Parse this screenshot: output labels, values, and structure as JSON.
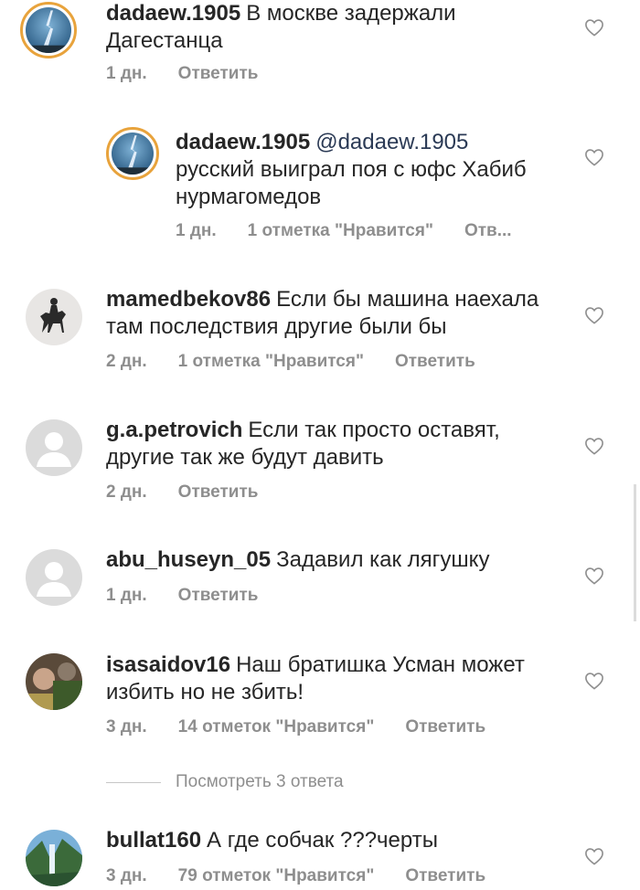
{
  "comments": [
    {
      "username": "dadaew.1905",
      "text": "В москве задержали Дагестанца",
      "time": "1 дн.",
      "reply": "Ответить"
    },
    {
      "username": "dadaew.1905",
      "mention": "@dadaew.1905",
      "text": "русский выиграл поя с юфс  Хабиб нурмагомедов",
      "time": "1 дн.",
      "likes": "1 отметка \"Нравится\"",
      "reply": "Отв..."
    },
    {
      "username": "mamedbekov86",
      "text": "Если бы машина наехала там последствия другие были бы",
      "time": "2 дн.",
      "likes": "1 отметка \"Нравится\"",
      "reply": "Ответить"
    },
    {
      "username": "g.a.petrovich",
      "text": "Если так просто оставят, другие так же будут давить",
      "time": "2 дн.",
      "reply": "Ответить"
    },
    {
      "username": "abu_huseyn_05",
      "text": "Задавил как лягушку",
      "time": "1 дн.",
      "reply": "Ответить"
    },
    {
      "username": "isasaidov16",
      "text": "Наш братишка Усман может избить но не збить!",
      "time": "3 дн.",
      "likes": "14 отметок \"Нравится\"",
      "reply": "Ответить"
    },
    {
      "username": "bullat160",
      "text": "А где собчак ???черты",
      "time": "3 дн.",
      "likes": "79 отметок \"Нравится\"",
      "reply": "Ответить"
    }
  ],
  "view_replies": "Посмотреть 3 ответа",
  "colors": {
    "text": "#262626",
    "meta": "#8e8e8e",
    "story_ring": "#e8a33c"
  },
  "icons": {
    "like": "heart-outline-icon"
  }
}
